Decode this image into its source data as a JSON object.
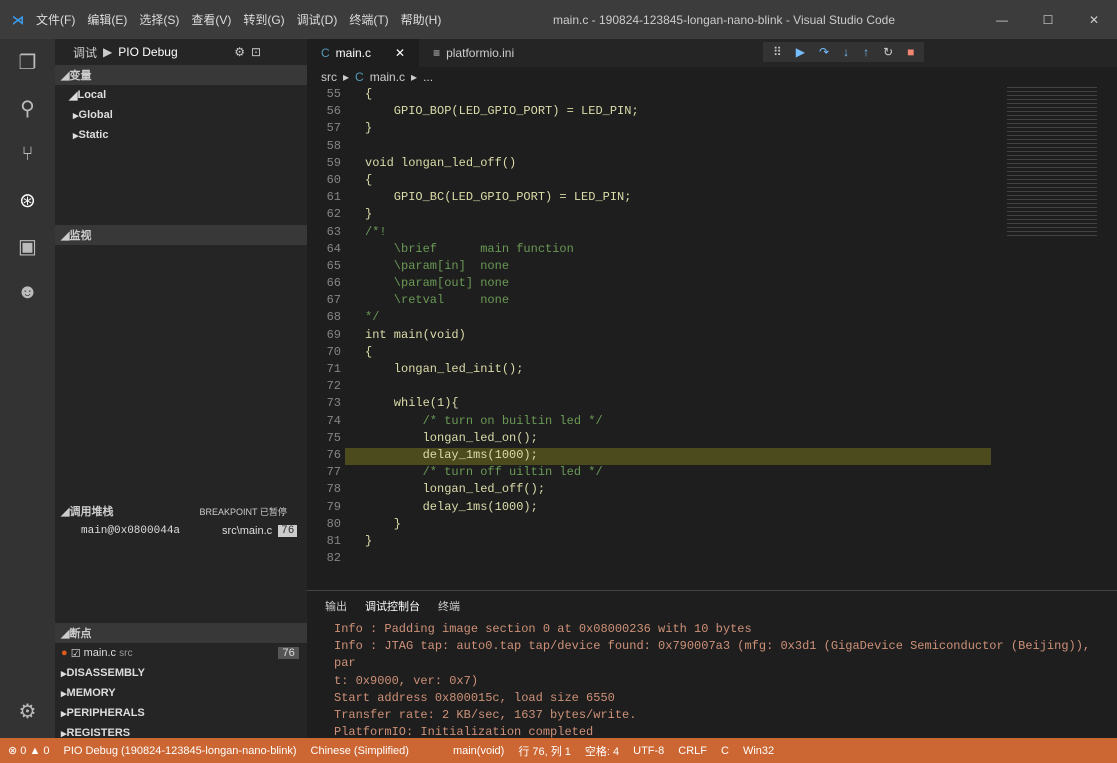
{
  "title": "main.c - 190824-123845-longan-nano-blink - Visual Studio Code",
  "menu": [
    "文件(F)",
    "编辑(E)",
    "选择(S)",
    "查看(V)",
    "转到(G)",
    "调试(D)",
    "终端(T)",
    "帮助(H)"
  ],
  "sidebar": {
    "debug_label": "调试",
    "config": "PIO Debug",
    "variables": "变量",
    "vars": [
      "Local",
      "Global",
      "Static"
    ],
    "watch": "监视",
    "callstack": "调用堆栈",
    "paused": "BREAKPOINT 已暂停",
    "frame": "main@0x0800044a",
    "frame_file": "src\\main.c",
    "frame_line": "76",
    "breakpoints": "断点",
    "bp_file": "main.c",
    "bp_dir": "src",
    "bp_line": "76",
    "sections": [
      "DISASSEMBLY",
      "MEMORY",
      "PERIPHERALS",
      "REGISTERS"
    ]
  },
  "tabs": [
    "main.c",
    "platformio.ini"
  ],
  "crumbs": {
    "a": "src",
    "b": "main.c",
    "c": "..."
  },
  "code": [
    [
      "55",
      "{"
    ],
    [
      "56",
      "    GPIO_BOP(LED_GPIO_PORT) = LED_PIN;"
    ],
    [
      "57",
      "}"
    ],
    [
      "58",
      ""
    ],
    [
      "59",
      "void longan_led_off()"
    ],
    [
      "60",
      "{"
    ],
    [
      "61",
      "    GPIO_BC(LED_GPIO_PORT) = LED_PIN;"
    ],
    [
      "62",
      "}"
    ],
    [
      "63",
      "/*!"
    ],
    [
      "64",
      "    \\brief      main function"
    ],
    [
      "65",
      "    \\param[in]  none"
    ],
    [
      "66",
      "    \\param[out] none"
    ],
    [
      "67",
      "    \\retval     none"
    ],
    [
      "68",
      "*/"
    ],
    [
      "69",
      "int main(void)"
    ],
    [
      "70",
      "{"
    ],
    [
      "71",
      "    longan_led_init();"
    ],
    [
      "72",
      ""
    ],
    [
      "73",
      "    while(1){"
    ],
    [
      "74",
      "        /* turn on builtin led */"
    ],
    [
      "75",
      "        longan_led_on();"
    ],
    [
      "76",
      "        delay_1ms(1000);"
    ],
    [
      "77",
      "        /* turn off uiltin led */"
    ],
    [
      "78",
      "        longan_led_off();"
    ],
    [
      "79",
      "        delay_1ms(1000);"
    ],
    [
      "80",
      "    }"
    ],
    [
      "81",
      "}"
    ],
    [
      "82",
      ""
    ]
  ],
  "panel": {
    "tabs": [
      "输出",
      "调试控制台",
      "终端"
    ],
    "lines": [
      "Info : Padding image section 0 at 0x08000236 with 10 bytes",
      "Info : JTAG tap: auto0.tap tap/device found: 0x790007a3 (mfg: 0x3d1 (GigaDevice Semiconductor (Beijing)), par",
      "t: 0x9000, ver: 0x7)",
      "Start address 0x800015c, load size 6550",
      "Transfer rate: 2 KB/sec, 1637 bytes/write.",
      "PlatformIO: Initialization completed"
    ]
  },
  "status": [
    "⊗ 0 ▲ 0",
    "PIO Debug (190824-123845-longan-nano-blink)",
    "Chinese (Simplified)",
    "main(void)",
    "行 76, 列 1",
    "空格: 4",
    "UTF-8",
    "CRLF",
    "C",
    "Win32"
  ]
}
